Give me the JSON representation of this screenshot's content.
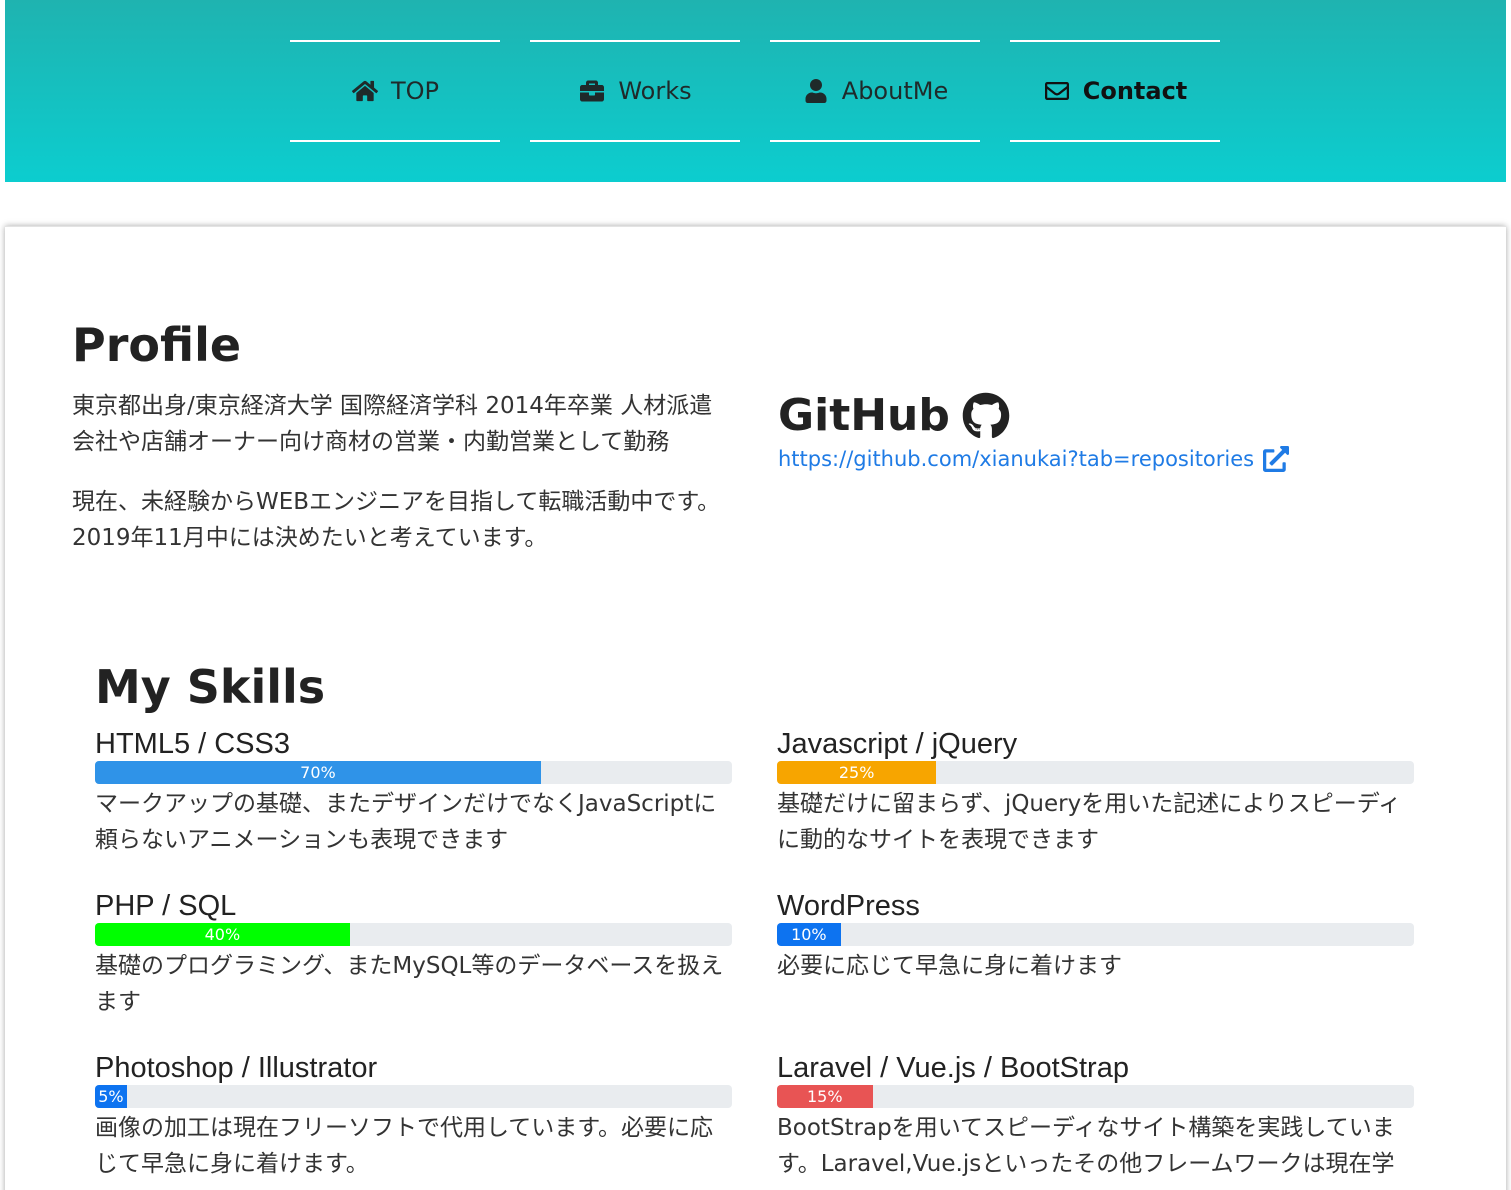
{
  "nav": {
    "items": [
      {
        "label": "TOP",
        "icon": "home-icon"
      },
      {
        "label": "Works",
        "icon": "briefcase-icon"
      },
      {
        "label": "AboutMe",
        "icon": "user-icon"
      },
      {
        "label": "Contact",
        "icon": "envelope-icon",
        "active": true
      }
    ]
  },
  "profile": {
    "title": "Profile",
    "paragraph1": "東京都出身/東京経済大学 国際経済学科 2014年卒業 人材派遣会社や店舗オーナー向け商材の営業・内勤営業として勤務",
    "paragraph2": "現在、未経験からWEBエンジニアを目指して転職活動中です。 2019年11月中には決めたいと考えています。"
  },
  "github": {
    "title": "GitHub",
    "icon": "github-icon",
    "link": "https://github.com/xianukai?tab=repositories",
    "link_icon": "external-link-icon"
  },
  "skills": {
    "title": "My Skills",
    "items": [
      {
        "name": "HTML5 / CSS3",
        "percent": 70,
        "label": "70%",
        "color": "#2f93e8",
        "desc": "マークアップの基礎、またデザインだけでなくJavaScriptに頼らないアニメーションも表現できます"
      },
      {
        "name": "Javascript / jQuery",
        "percent": 25,
        "label": "25%",
        "color": "#f7a500",
        "desc": "基礎だけに留まらず、jQueryを用いた記述によりスピーディに動的なサイトを表現できます"
      },
      {
        "name": "PHP / SQL",
        "percent": 40,
        "label": "40%",
        "color": "#00ff00",
        "desc": "基礎のプログラミング、またMySQL等のデータベースを扱えます"
      },
      {
        "name": "WordPress",
        "percent": 10,
        "label": "10%",
        "color": "#0d73f0",
        "desc": "必要に応じて早急に身に着けます"
      },
      {
        "name": "Photoshop / Illustrator",
        "percent": 5,
        "label": "5%",
        "color": "#0d73f0",
        "desc": "画像の加工は現在フリーソフトで代用しています。必要に応じて早急に身に着けます。"
      },
      {
        "name": "Laravel / Vue.js / BootStrap",
        "percent": 15,
        "label": "15%",
        "color": "#e85454",
        "desc": "BootStrapを用いてスピーディなサイト構築を実践しています。Laravel,Vue.jsといったその他フレームワークは現在学"
      }
    ]
  }
}
